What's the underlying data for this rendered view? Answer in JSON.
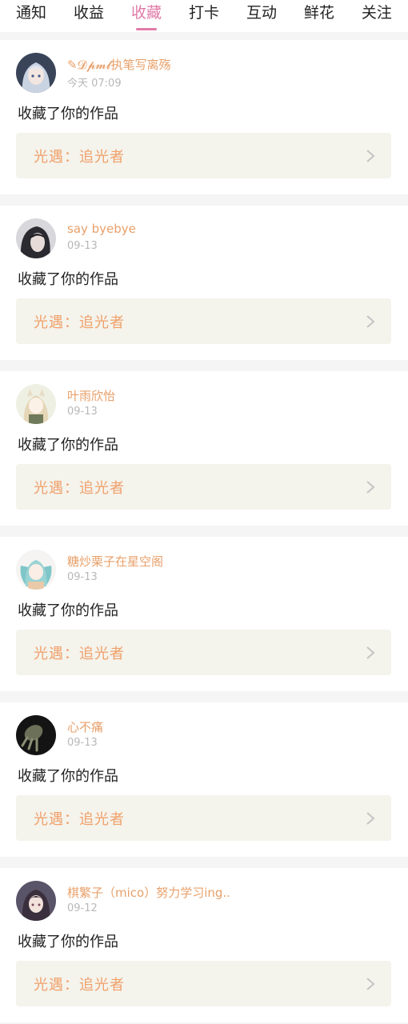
{
  "tabs": [
    {
      "label": "通知",
      "active": false
    },
    {
      "label": "收益",
      "active": false
    },
    {
      "label": "收藏",
      "active": true
    },
    {
      "label": "打卡",
      "active": false
    },
    {
      "label": "互动",
      "active": false
    },
    {
      "label": "鲜花",
      "active": false
    },
    {
      "label": "关注",
      "active": false
    }
  ],
  "accent_color": "#e07aa8",
  "name_color": "#e8a06a",
  "notifications": [
    {
      "user": "✎𝓓𝓹𝓶𝓵执笔写离殇",
      "time": "今天 07:09",
      "action": "收藏了你的作品",
      "work": "光遇：追光者",
      "avatar_icon": "anime-girl-silver-hair-avatar"
    },
    {
      "user": "say byebye",
      "time": "09-13",
      "action": "收藏了你的作品",
      "work": "光遇：追光者",
      "avatar_icon": "dark-hair-portrait-avatar"
    },
    {
      "user": "叶雨欣怡",
      "time": "09-13",
      "action": "收藏了你的作品",
      "work": "光遇：追光者",
      "avatar_icon": "anime-cat-ear-girl-avatar"
    },
    {
      "user": "糖炒栗子在星空阁",
      "time": "09-13",
      "action": "收藏了你的作品",
      "work": "光遇：追光者",
      "avatar_icon": "anime-teal-twintail-avatar"
    },
    {
      "user": "心不痛",
      "time": "09-13",
      "action": "收藏了你的作品",
      "work": "光遇：追光者",
      "avatar_icon": "dark-hand-avatar"
    },
    {
      "user": "棋繁子（mico）努力学习ing..",
      "time": "09-12",
      "action": "收藏了你的作品",
      "work": "光遇：追光者",
      "avatar_icon": "anime-dark-hair-girl-avatar"
    }
  ]
}
